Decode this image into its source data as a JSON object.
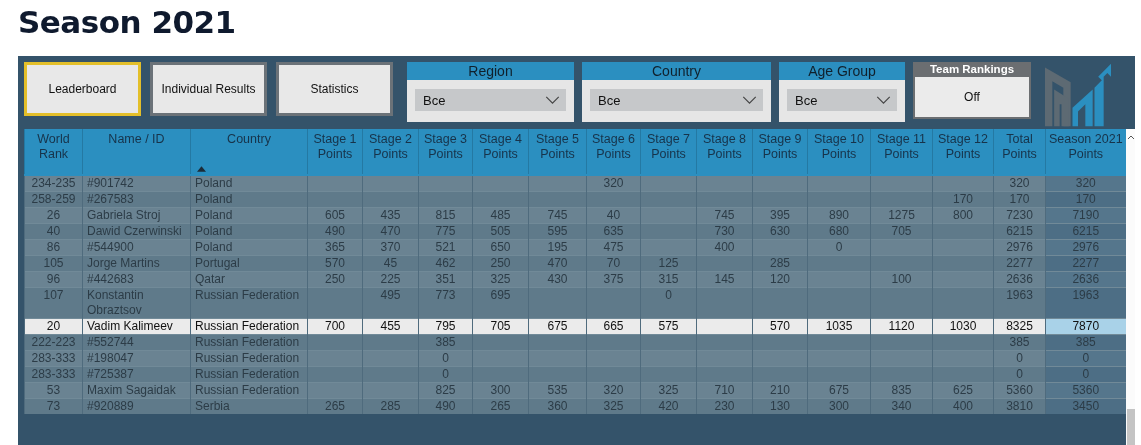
{
  "page_title": "Season 2021",
  "nav_buttons": [
    {
      "label": "Leaderboard",
      "selected": true
    },
    {
      "label": "Individual Results",
      "selected": false
    },
    {
      "label": "Statistics",
      "selected": false
    }
  ],
  "filters": [
    {
      "label": "Region",
      "value": "Все"
    },
    {
      "label": "Country",
      "value": "Все"
    },
    {
      "label": "Age Group",
      "value": "Все"
    }
  ],
  "team_rankings": {
    "title": "Team Rankings",
    "value": "Off"
  },
  "table": {
    "columns": [
      {
        "label": "World Rank",
        "sorted": false
      },
      {
        "label": "Name / ID",
        "sorted": false
      },
      {
        "label": "Country",
        "sorted": true
      },
      {
        "label": "Stage 1 Points",
        "sorted": false
      },
      {
        "label": "Stage 2 Points",
        "sorted": false
      },
      {
        "label": "Stage 3 Points",
        "sorted": false
      },
      {
        "label": "Stage 4 Points",
        "sorted": false
      },
      {
        "label": "Stage 5 Points",
        "sorted": false
      },
      {
        "label": "Stage 6 Points",
        "sorted": false
      },
      {
        "label": "Stage 7 Points",
        "sorted": false
      },
      {
        "label": "Stage 8 Points",
        "sorted": false
      },
      {
        "label": "Stage 9 Points",
        "sorted": false
      },
      {
        "label": "Stage 10 Points",
        "sorted": false
      },
      {
        "label": "Stage 11 Points",
        "sorted": false
      },
      {
        "label": "Stage 12 Points",
        "sorted": false
      },
      {
        "label": "Total Points",
        "sorted": false
      },
      {
        "label": "Season 2021 Points",
        "sorted": false
      }
    ],
    "rows": [
      {
        "rank": "234-235",
        "name": "#901742",
        "country": "Poland",
        "stages": {
          "stage_6": "320"
        },
        "total": "320",
        "season": "320",
        "selected": false
      },
      {
        "rank": "258-259",
        "name": "#267583",
        "country": "Poland",
        "stages": {
          "stage_12": "170"
        },
        "total": "170",
        "season": "170",
        "selected": false
      },
      {
        "rank": "26",
        "name": "Gabriela Stroj",
        "country": "Poland",
        "stages": {
          "stage_1": "605",
          "stage_2": "435",
          "stage_3": "815",
          "stage_4": "485",
          "stage_5": "745",
          "stage_6": "40",
          "stage_8": "745",
          "stage_9": "395",
          "stage_10": "890",
          "stage_11": "1275",
          "stage_12": "800"
        },
        "total": "7230",
        "season": "7190",
        "selected": false
      },
      {
        "rank": "40",
        "name": "Dawid Czerwinski",
        "country": "Poland",
        "stages": {
          "stage_1": "490",
          "stage_2": "470",
          "stage_3": "775",
          "stage_4": "505",
          "stage_5": "595",
          "stage_6": "635",
          "stage_8": "730",
          "stage_9": "630",
          "stage_10": "680",
          "stage_11": "705"
        },
        "total": "6215",
        "season": "6215",
        "selected": false
      },
      {
        "rank": "86",
        "name": "#544900",
        "country": "Poland",
        "stages": {
          "stage_1": "365",
          "stage_2": "370",
          "stage_3": "521",
          "stage_4": "650",
          "stage_5": "195",
          "stage_6": "475",
          "stage_8": "400",
          "stage_10": "0"
        },
        "total": "2976",
        "season": "2976",
        "selected": false
      },
      {
        "rank": "105",
        "name": "Jorge Martins",
        "country": "Portugal",
        "stages": {
          "stage_1": "570",
          "stage_2": "45",
          "stage_3": "462",
          "stage_4": "250",
          "stage_5": "470",
          "stage_6": "70",
          "stage_7": "125",
          "stage_9": "285"
        },
        "total": "2277",
        "season": "2277",
        "selected": false
      },
      {
        "rank": "96",
        "name": "#442683",
        "country": "Qatar",
        "stages": {
          "stage_1": "250",
          "stage_2": "225",
          "stage_3": "351",
          "stage_4": "325",
          "stage_5": "430",
          "stage_6": "375",
          "stage_7": "315",
          "stage_8": "145",
          "stage_9": "120",
          "stage_11": "100"
        },
        "total": "2636",
        "season": "2636",
        "selected": false
      },
      {
        "rank": "107",
        "name": "Konstantin Obraztsov",
        "country": "Russian Federation",
        "stages": {
          "stage_2": "495",
          "stage_3": "773",
          "stage_4": "695",
          "stage_7": "0"
        },
        "total": "1963",
        "season": "1963",
        "selected": false
      },
      {
        "rank": "20",
        "name": "Vadim Kalimeev",
        "country": "Russian Federation",
        "stages": {
          "stage_1": "700",
          "stage_2": "455",
          "stage_3": "795",
          "stage_4": "705",
          "stage_5": "675",
          "stage_6": "665",
          "stage_7": "575",
          "stage_9": "570",
          "stage_10": "1035",
          "stage_11": "1120",
          "stage_12": "1030"
        },
        "total": "8325",
        "season": "7870",
        "selected": true
      },
      {
        "rank": "222-223",
        "name": "#552744",
        "country": "Russian Federation",
        "stages": {
          "stage_3": "385"
        },
        "total": "385",
        "season": "385",
        "selected": false
      },
      {
        "rank": "283-333",
        "name": "#198047",
        "country": "Russian Federation",
        "stages": {
          "stage_3": "0"
        },
        "total": "0",
        "season": "0",
        "selected": false
      },
      {
        "rank": "283-333",
        "name": "#725387",
        "country": "Russian Federation",
        "stages": {
          "stage_3": "0"
        },
        "total": "0",
        "season": "0",
        "selected": false
      },
      {
        "rank": "53",
        "name": "Maxim Sagaidak",
        "country": "Russian Federation",
        "stages": {
          "stage_3": "825",
          "stage_4": "300",
          "stage_5": "535",
          "stage_6": "320",
          "stage_7": "325",
          "stage_8": "710",
          "stage_9": "210",
          "stage_10": "675",
          "stage_11": "835",
          "stage_12": "625"
        },
        "total": "5360",
        "season": "5360",
        "selected": false
      },
      {
        "rank": "73",
        "name": "#920889",
        "country": "Serbia",
        "stages": {
          "stage_1": "265",
          "stage_2": "285",
          "stage_3": "490",
          "stage_4": "265",
          "stage_5": "360",
          "stage_6": "325",
          "stage_7": "420",
          "stage_8": "230",
          "stage_9": "130",
          "stage_10": "300",
          "stage_11": "340",
          "stage_12": "400"
        },
        "total": "3810",
        "season": "3450",
        "selected": false
      }
    ]
  }
}
